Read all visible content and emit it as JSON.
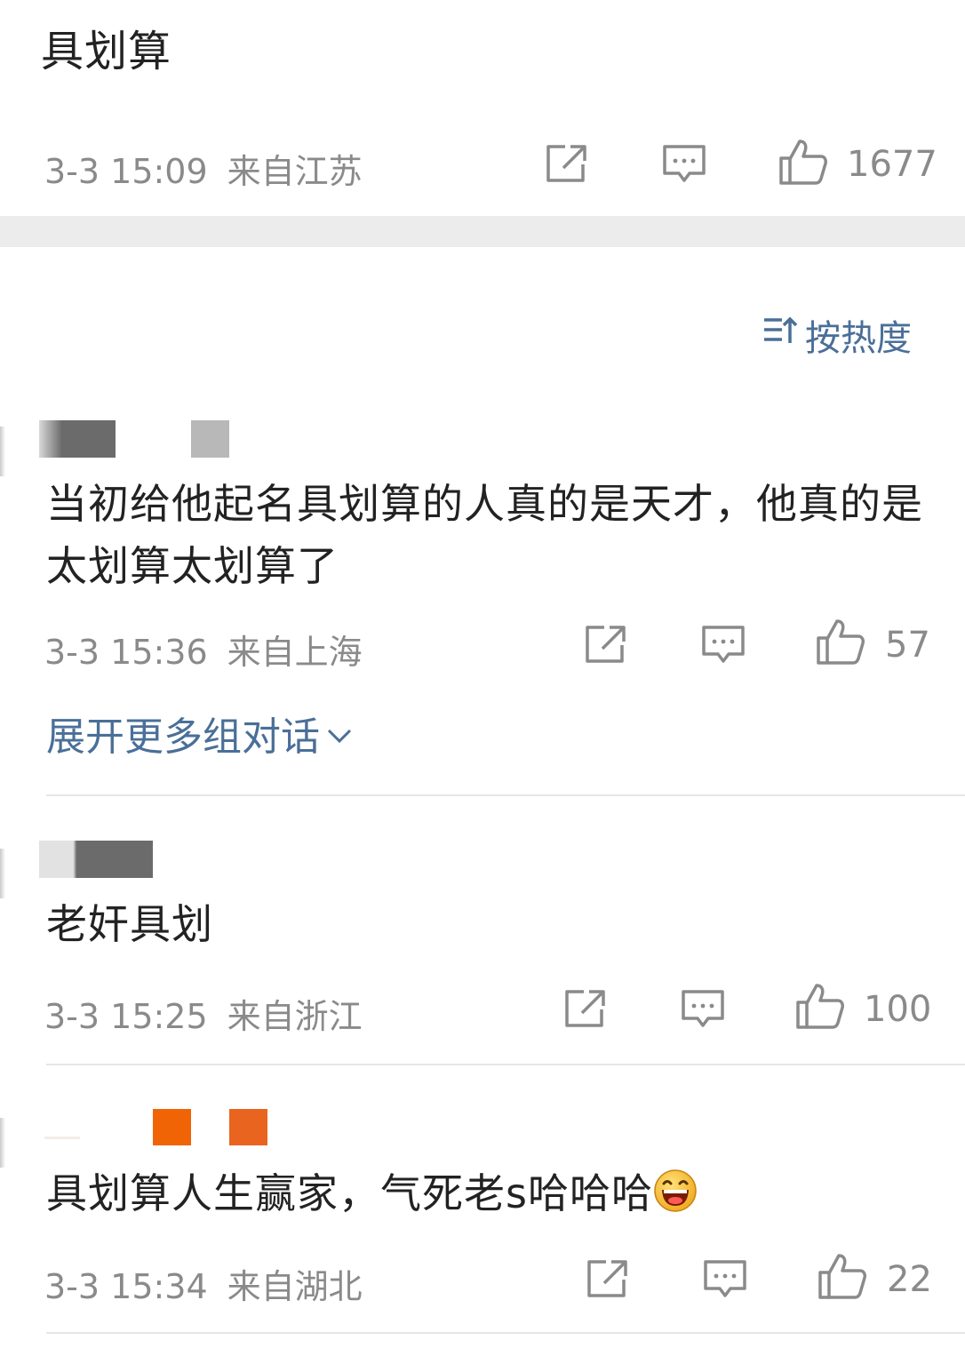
{
  "post": {
    "text": "具划算",
    "date": "3-3 15:09",
    "source": "来自江苏",
    "like_count": "1677"
  },
  "sort_label": "按热度",
  "comments": [
    {
      "text": "当初给他起名具划算的人真的是天才，他真的是太划算太划算了",
      "date": "3-3 15:36",
      "source": "来自上海",
      "like_count": "57",
      "expand_label": "展开更多组对话"
    },
    {
      "text": "老奸具划",
      "date": "3-3 15:25",
      "source": "来自浙江",
      "like_count": "100"
    },
    {
      "text": "具划算人生赢家，气死老s哈哈哈",
      "date": "3-3 15:34",
      "source": "来自湖北",
      "like_count": "22",
      "emoji": "laughing-face"
    }
  ],
  "colors": {
    "link": "#4a6f98",
    "meta_text": "#8a8a8a",
    "icon_stroke": "#8a8a8a",
    "separator_band": "#ececec",
    "redaction_gray": "#6b6b6b",
    "redaction_light": "#b8b8b8",
    "redaction_orange": "#f06405"
  },
  "icons": [
    "repost-icon",
    "comment-icon",
    "like-icon",
    "sort-icon",
    "chevron-down-icon"
  ]
}
